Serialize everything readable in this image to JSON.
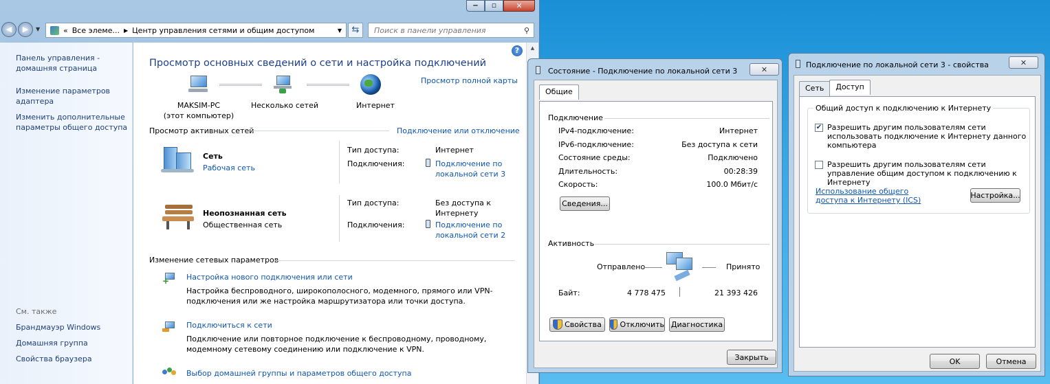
{
  "w1": {
    "addr": {
      "seg1": "Все элеме...",
      "seg2": "Центр управления сетями и общим доступом"
    },
    "search_placeholder": "Поиск в панели управления",
    "sidebar": {
      "home": "Панель управления - домашняя страница",
      "adapter": "Изменение параметров адаптера",
      "sharing": "Изменить дополнительные параметры общего доступа",
      "see_also": "См. также",
      "firewall": "Брандмауэр Windows",
      "homegroup": "Домашняя группа",
      "browser": "Свойства браузера"
    },
    "title": "Просмотр основных сведений о сети и настройка подключений",
    "full_map": "Просмотр полной карты",
    "map": {
      "pc": "MAKSIM-PC",
      "pc_sub": "(этот компьютер)",
      "nets": "Несколько сетей",
      "internet": "Интернет"
    },
    "active_title": "Просмотр активных сетей",
    "connect_disconnect": "Подключение или отключение",
    "net1": {
      "name": "Сеть",
      "type": "Рабочая сеть",
      "access_label": "Тип доступа:",
      "access": "Интернет",
      "conn_label": "Подключения:",
      "conn": "Подключение по локальной сети 3"
    },
    "net2": {
      "name": "Неопознанная сеть",
      "type": "Общественная сеть",
      "access_label": "Тип доступа:",
      "access": "Без доступа к Интернету",
      "conn_label": "Подключения:",
      "conn": "Подключение по локальной сети 2"
    },
    "change_title": "Изменение сетевых параметров",
    "tasks": [
      {
        "link": "Настройка нового подключения или сети",
        "desc": "Настройка беспроводного, широкополосного, модемного, прямого или VPN-подключения или же настройка маршрутизатора или точки доступа."
      },
      {
        "link": "Подключиться к сети",
        "desc": "Подключение или повторное подключение к беспроводному, проводному, модемному сетевому соединению или подключение к VPN."
      },
      {
        "link": "Выбор домашней группы и параметров общего доступа",
        "desc": ""
      }
    ]
  },
  "w2": {
    "title": "Состояние - Подключение по локальной сети 3",
    "tab": "Общие",
    "conn_group": "Подключение",
    "rows": [
      {
        "k": "IPv4-подключение:",
        "v": "Интернет"
      },
      {
        "k": "IPv6-подключение:",
        "v": "Без доступа к сети"
      },
      {
        "k": "Состояние среды:",
        "v": "Подключено"
      },
      {
        "k": "Длительность:",
        "v": "00:28:39"
      },
      {
        "k": "Скорость:",
        "v": "100.0 Мбит/с"
      }
    ],
    "details": "Сведения...",
    "activity": "Активность",
    "sent": "Отправлено",
    "recv": "Принято",
    "bytes": "Байт:",
    "sent_val": "4 778 475",
    "recv_val": "21 393 426",
    "props": "Свойства",
    "disable": "Отключить",
    "diag": "Диагностика",
    "close": "Закрыть"
  },
  "w3": {
    "title": "Подключение по локальной сети 3 - свойства",
    "tab1": "Сеть",
    "tab2": "Доступ",
    "group": "Общий доступ к подключению к Интернету",
    "chk1": "Разрешить другим пользователям сети использовать подключение к Интернету данного компьютера",
    "chk1_checked": true,
    "chk2": "Разрешить другим пользователям сети управление общим доступом к подключению к Интернету",
    "chk2_checked": false,
    "ics_link": "Использование общего доступа к Интернету (ICS)",
    "settings": "Настройка...",
    "ok": "OK",
    "cancel": "Отмена"
  }
}
